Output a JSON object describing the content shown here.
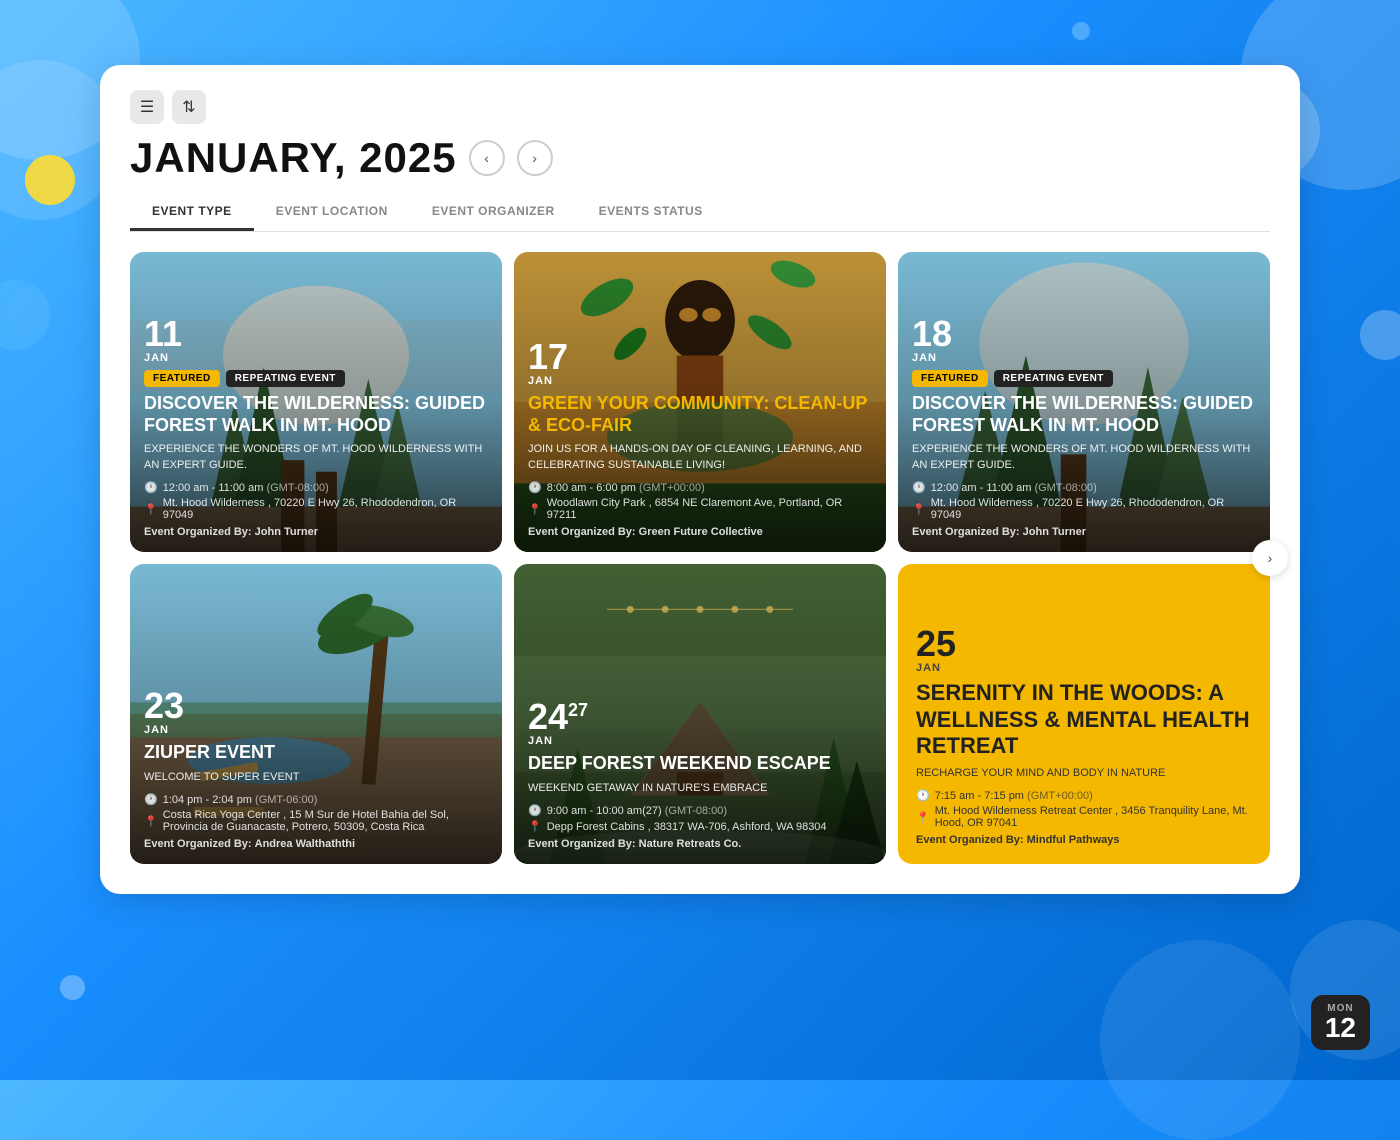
{
  "page": {
    "background": "gradient-blue"
  },
  "header": {
    "month_title": "JANUARY, 2025",
    "filter_icon_label": "≡",
    "nav_prev": "‹",
    "nav_next": "›"
  },
  "filter_tabs": [
    {
      "label": "EVENT TYPE",
      "active": true
    },
    {
      "label": "EVENT LOCATION",
      "active": false
    },
    {
      "label": "EVENT ORGANIZER",
      "active": false
    },
    {
      "label": "EVENTS STATUS",
      "active": false
    }
  ],
  "events": [
    {
      "id": "event-1",
      "date_num": "11",
      "date_superscript": "",
      "date_month": "JAN",
      "badges": [
        "FEATURED",
        "REPEATING EVENT"
      ],
      "title": "DISCOVER THE WILDERNESS: GUIDED FOREST WALK IN MT. HOOD",
      "description": "EXPERIENCE THE WONDERS OF MT. HOOD WILDERNESS WITH AN EXPERT GUIDE.",
      "time": "12:00 am - 11:00 am",
      "timezone": "(GMT-08:00)",
      "location": "Mt. Hood Wilderness , 70220 E Hwy 26, Rhododendron, OR 97049",
      "organizer_label": "Event Organized By:",
      "organizer": "John Turner",
      "bg_type": "forest",
      "card_type": "image"
    },
    {
      "id": "event-2",
      "date_num": "17",
      "date_superscript": "",
      "date_month": "JAN",
      "badges": [],
      "title": "GREEN YOUR COMMUNITY: CLEAN-UP & ECO-FAIR",
      "description": "JOIN US FOR A HANDS-ON DAY OF CLEANING, LEARNING, AND CELEBRATING SUSTAINABLE LIVING!",
      "time": "8:00 am - 6:00 pm",
      "timezone": "(GMT+00:00)",
      "location": "Woodlawn City Park , 6854 NE Claremont Ave, Portland, OR 97211",
      "organizer_label": "Event Organized By:",
      "organizer": "Green Future Collective",
      "bg_type": "green",
      "card_type": "image"
    },
    {
      "id": "event-3",
      "date_num": "18",
      "date_superscript": "",
      "date_month": "JAN",
      "badges": [
        "FEATURED",
        "REPEATING EVENT"
      ],
      "title": "DISCOVER THE WILDERNESS: GUIDED FOREST WALK IN MT. HOOD",
      "description": "EXPERIENCE THE WONDERS OF MT. HOOD WILDERNESS WITH AN EXPERT GUIDE.",
      "time": "12:00 am - 11:00 am",
      "timezone": "(GMT-08:00)",
      "location": "Mt. Hood Wilderness , 70220 E Hwy 26, Rhododendron, OR 97049",
      "organizer_label": "Event Organized By:",
      "organizer": "John Turner",
      "bg_type": "forest",
      "card_type": "image"
    },
    {
      "id": "event-4",
      "date_num": "23",
      "date_superscript": "",
      "date_month": "JAN",
      "badges": [],
      "title": "ZIUPER EVENT",
      "description": "WELCOME TO SUPER EVENT",
      "time": "1:04 pm - 2:04 pm",
      "timezone": "(GMT-06:00)",
      "location": "Costa Rica Yoga Center , 15 M Sur de Hotel Bahia del Sol, Provincia de Guanacaste, Potrero, 50309, Costa Rica",
      "organizer_label": "Event Organized By:",
      "organizer": "Andrea Walthaththi",
      "bg_type": "beach",
      "card_type": "image"
    },
    {
      "id": "event-5",
      "date_num": "24",
      "date_superscript": "27",
      "date_month": "JAN",
      "badges": [],
      "title": "DEEP FOREST WEEKEND ESCAPE",
      "description": "WEEKEND GETAWAY IN NATURE'S EMBRACE",
      "time": "9:00 am - 10:00 am",
      "time_extra": "(27)",
      "timezone": "(GMT-08:00)",
      "location": "Depp Forest Cabins , 38317 WA-706, Ashford, WA 98304",
      "organizer_label": "Event Organized By:",
      "organizer": "Nature Retreats Co.",
      "bg_type": "jungle",
      "card_type": "image"
    },
    {
      "id": "event-6",
      "date_num": "25",
      "date_superscript": "",
      "date_month": "JAN",
      "badges": [],
      "title": "SERENITY IN THE WOODS: A WELLNESS & MENTAL HEALTH RETREAT",
      "description": "RECHARGE YOUR MIND AND BODY IN NATURE",
      "time": "7:15 am - 7:15 pm",
      "timezone": "(GMT+00:00)",
      "location": "Mt. Hood Wilderness Retreat Center , 3456 Tranquility Lane, Mt. Hood, OR 97041",
      "organizer_label": "Event Organized By:",
      "organizer": "Mindful Pathways",
      "bg_type": "yellow",
      "card_type": "yellow"
    }
  ],
  "date_badge": {
    "day": "MON",
    "num": "12"
  },
  "icons": {
    "filter": "⚙",
    "filter2": "↕",
    "clock": "🕐",
    "pin": "📍",
    "prev": "‹",
    "next": "›",
    "scroll_right": "›"
  }
}
